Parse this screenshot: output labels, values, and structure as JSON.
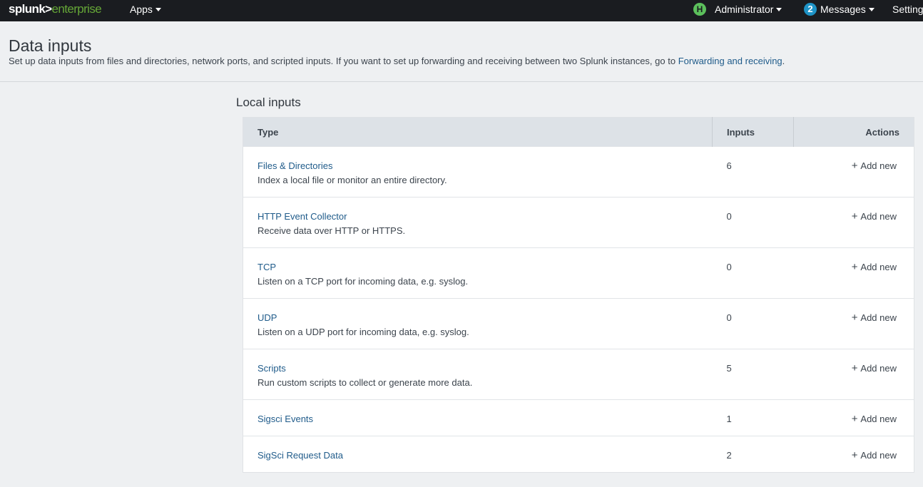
{
  "topbar": {
    "logo_part1": "splunk>",
    "logo_part2": "enterprise",
    "apps_label": "Apps",
    "user_initial": "H",
    "user_label": "Administrator",
    "messages_count": "2",
    "messages_label": "Messages",
    "settings_label": "Settings"
  },
  "header": {
    "title": "Data inputs",
    "description": "Set up data inputs from files and directories, network ports, and scripted inputs. If you want to set up forwarding and receiving between two Splunk instances, go to ",
    "link_text": "Forwarding and receiving",
    "description_end": "."
  },
  "local_inputs": {
    "title": "Local inputs",
    "columns": {
      "type": "Type",
      "inputs": "Inputs",
      "actions": "Actions"
    },
    "rows": [
      {
        "name": "Files & Directories",
        "description": "Index a local file or monitor an entire directory.",
        "count": "6",
        "action": "Add new"
      },
      {
        "name": "HTTP Event Collector",
        "description": "Receive data over HTTP or HTTPS.",
        "count": "0",
        "action": "Add new"
      },
      {
        "name": "TCP",
        "description": "Listen on a TCP port for incoming data, e.g. syslog.",
        "count": "0",
        "action": "Add new"
      },
      {
        "name": "UDP",
        "description": "Listen on a UDP port for incoming data, e.g. syslog.",
        "count": "0",
        "action": "Add new"
      },
      {
        "name": "Scripts",
        "description": "Run custom scripts to collect or generate more data.",
        "count": "5",
        "action": "Add new"
      },
      {
        "name": "Sigsci Events",
        "description": "",
        "count": "1",
        "action": "Add new"
      },
      {
        "name": "SigSci Request Data",
        "description": "",
        "count": "2",
        "action": "Add new"
      }
    ]
  },
  "colors": {
    "topbar_bg": "#1a1c20",
    "brand_green": "#65a637",
    "link_blue": "#1f5b8a",
    "badge_blue": "#1e93c6",
    "avatar_green": "#5cc05c",
    "page_bg": "#eef0f2",
    "table_header_bg": "#dde2e7"
  }
}
